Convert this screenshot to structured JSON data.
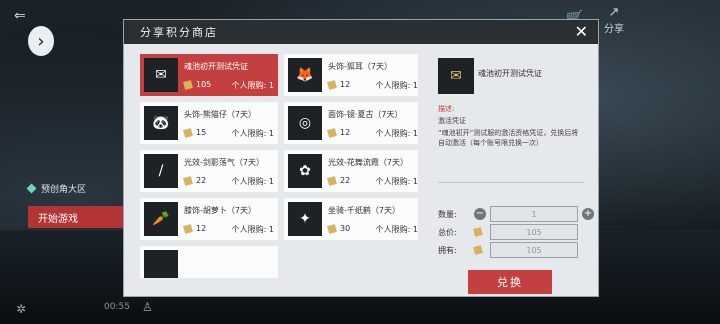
{
  "background": {
    "server_label": "预创角大区",
    "start_button": "开始游戏",
    "timer": "00:55",
    "share_label": "分享"
  },
  "modal": {
    "title": "分享积分商店",
    "close_icon": "close-icon",
    "items": [
      {
        "name": "魂池初开测试凭证",
        "price": "105",
        "limit": "个人限购: 1",
        "icon": "✉",
        "selected": true
      },
      {
        "name": "头饰-狐耳（7天）",
        "price": "12",
        "limit": "个人限购: 1",
        "icon": "🦊",
        "selected": false
      },
      {
        "name": "头饰-熊猫仔（7天）",
        "price": "15",
        "limit": "个人限购: 1",
        "icon": "🐼",
        "selected": false
      },
      {
        "name": "面饰-镜·夏古（7天）",
        "price": "12",
        "limit": "个人限购: 1",
        "icon": "◎",
        "selected": false
      },
      {
        "name": "光效-剑影荡气（7天）",
        "price": "22",
        "limit": "个人限购: 1",
        "icon": "/",
        "selected": false
      },
      {
        "name": "光效-花舞流霞（7天）",
        "price": "22",
        "limit": "个人限购: 1",
        "icon": "✿",
        "selected": false
      },
      {
        "name": "膝饰-胡萝卜（7天）",
        "price": "12",
        "limit": "个人限购: 1",
        "icon": "🥕",
        "selected": false
      },
      {
        "name": "坐骑-千纸鹤（7天）",
        "price": "30",
        "limit": "个人限购: 1",
        "icon": "✦",
        "selected": false
      }
    ],
    "detail": {
      "name": "魂池初开测试凭证",
      "desc_label": "描述:",
      "desc_type": "激活凭证",
      "desc_text": "“魂池初开”测试服的激活资格凭证，兑换后将自动激活（每个账号限兑换一次）",
      "qty_label": "数量:",
      "qty_value": "1",
      "total_label": "总价:",
      "total_value": "105",
      "owned_label": "拥有:",
      "owned_value": "105",
      "exchange_button": "兑换"
    }
  }
}
